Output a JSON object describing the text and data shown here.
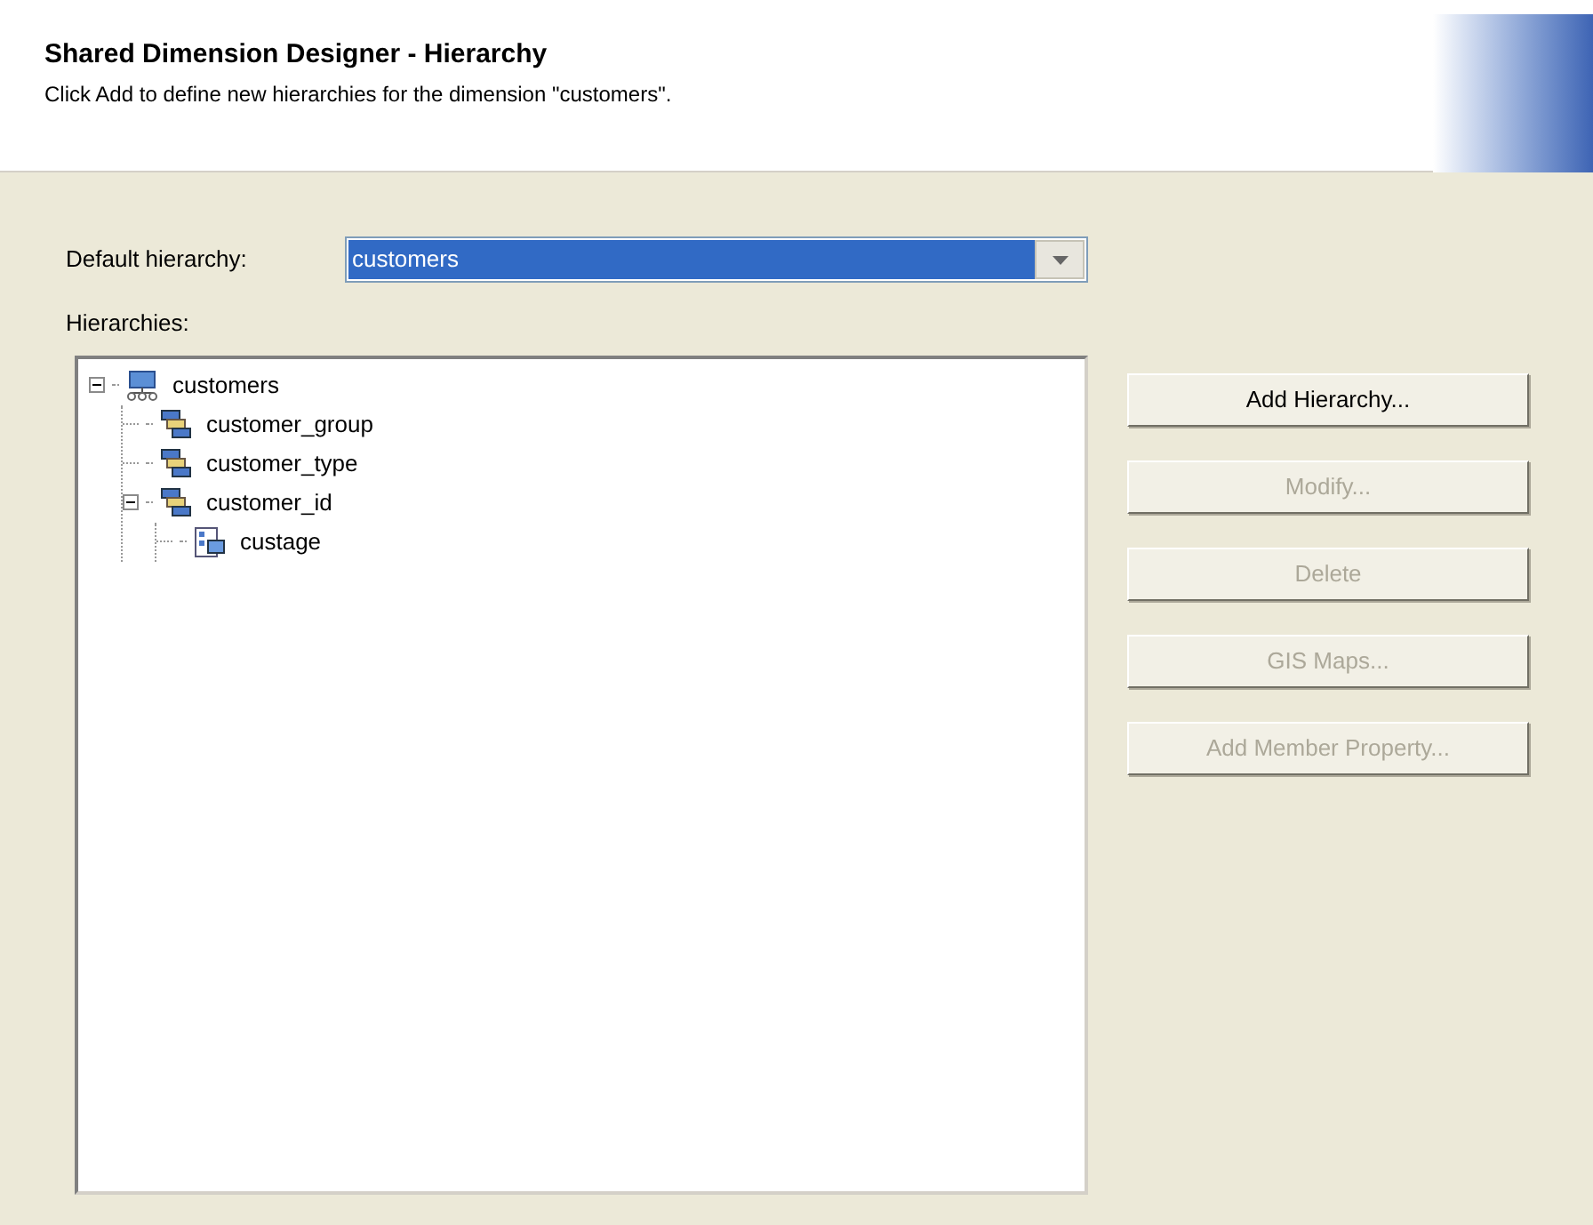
{
  "header": {
    "title": "Shared Dimension Designer - Hierarchy",
    "subtitle": "Click Add to define new hierarchies for the dimension \"customers\"."
  },
  "default_hierarchy": {
    "label": "Default hierarchy:",
    "value": "customers",
    "selected": true
  },
  "hierarchies": {
    "label": "Hierarchies:",
    "tree": [
      {
        "label": "customers",
        "kind": "dimension",
        "expanded": true,
        "children": [
          {
            "label": "customer_group",
            "kind": "level"
          },
          {
            "label": "customer_type",
            "kind": "level"
          },
          {
            "label": "customer_id",
            "kind": "level",
            "expanded": true,
            "children": [
              {
                "label": "custage",
                "kind": "property"
              }
            ]
          }
        ]
      }
    ]
  },
  "buttons": [
    {
      "label": "Add Hierarchy...",
      "disabled": false
    },
    {
      "label": "Modify...",
      "disabled": true
    },
    {
      "label": "Delete",
      "disabled": true
    },
    {
      "label": "GIS Maps...",
      "disabled": true
    },
    {
      "label": "Add Member Property...",
      "disabled": true
    }
  ]
}
